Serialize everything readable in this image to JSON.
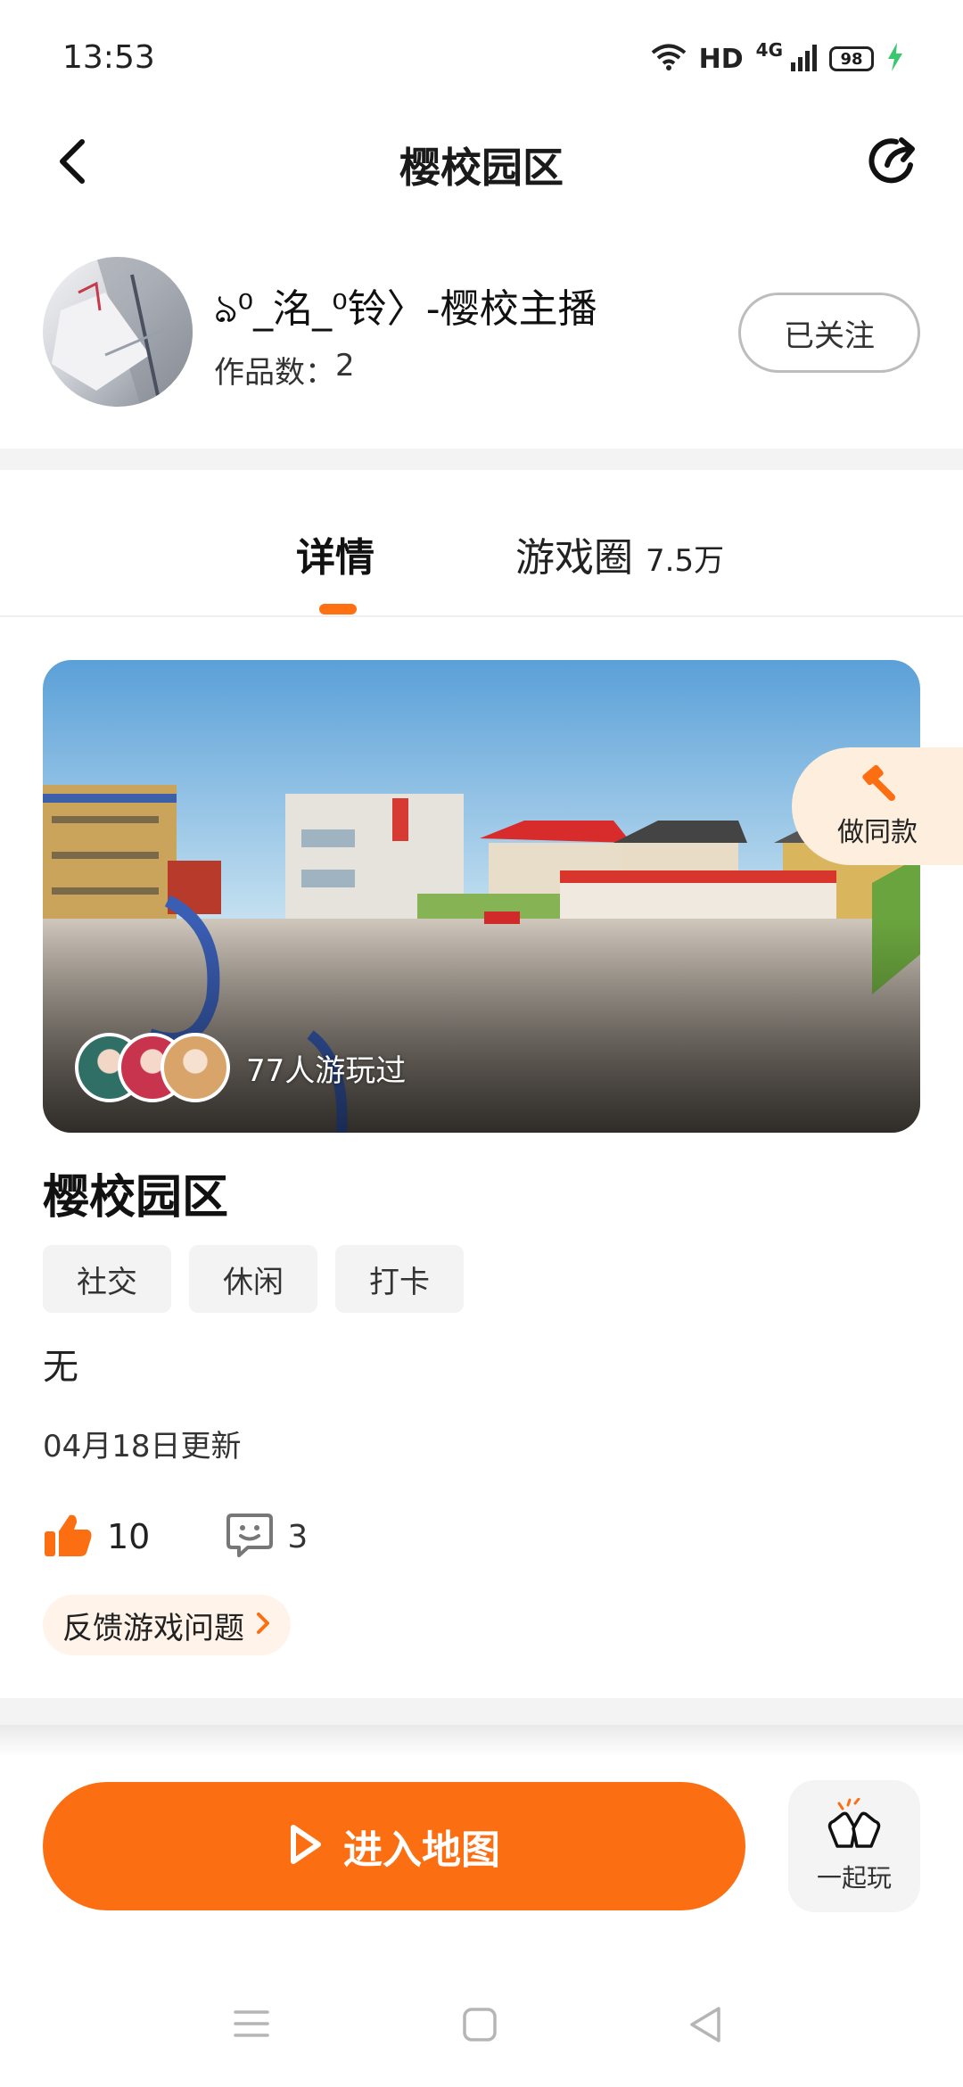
{
  "status_bar": {
    "time": "13:53",
    "hd": "HD",
    "network": "4G",
    "battery": "98"
  },
  "header": {
    "title": "樱校园区",
    "back_icon": "chevron-left-icon",
    "share_icon": "share-icon"
  },
  "author": {
    "name": "ঌ⁰_洺_⁰铃〉-樱校主播",
    "works_label": "作品数：",
    "works_count": "2",
    "follow_label": "已关注"
  },
  "tabs": [
    {
      "label": "详情",
      "active": true
    },
    {
      "label": "游戏圈",
      "count": "7.5万",
      "active": false
    }
  ],
  "banner": {
    "played_text": "77人游玩过",
    "make_same_label": "做同款"
  },
  "map": {
    "title": "樱校园区",
    "tags": [
      "社交",
      "休闲",
      "打卡"
    ],
    "description": "无",
    "updated": "04月18日更新",
    "likes": "10",
    "comments": "3",
    "feedback_label": "反馈游戏问题"
  },
  "actions": {
    "enter_label": "进入地图",
    "together_label": "一起玩"
  },
  "colors": {
    "accent": "#fb6f12",
    "tab_indicator": "#ff7013",
    "feedback_bg": "#fff3ea"
  }
}
